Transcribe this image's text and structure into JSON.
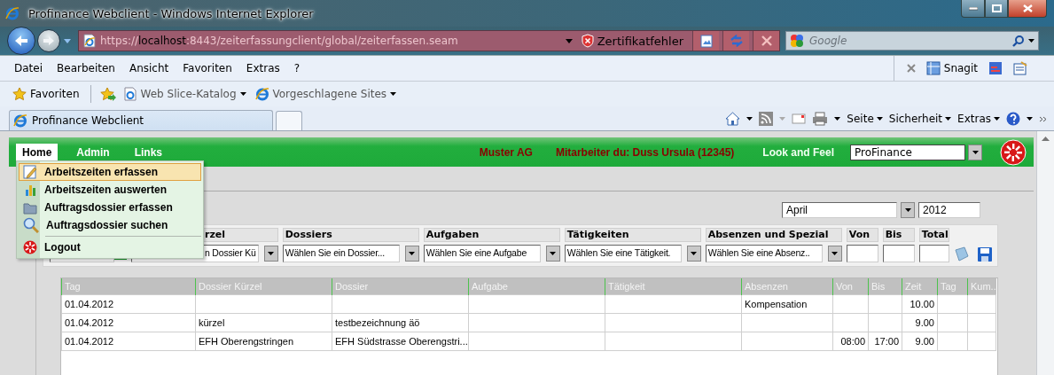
{
  "window": {
    "title": "Profinance Webclient - Windows Internet Explorer"
  },
  "address_bar": {
    "url_scheme": "https://",
    "host": "localhost",
    "url_path": ":8443/zeiterfassungclient/global/zeiterfassen.seam",
    "certificate_error": "Zertifikatfehler"
  },
  "search": {
    "placeholder": "Google"
  },
  "menu_bar": [
    "Datei",
    "Bearbeiten",
    "Ansicht",
    "Favoriten",
    "Extras",
    "?"
  ],
  "snagit": "Snagit",
  "favorites_bar": {
    "favorites": "Favoriten",
    "links": [
      "Web Slice-Katalog",
      "Vorgeschlagene Sites"
    ]
  },
  "tabs": [
    {
      "label": "Profinance Webclient",
      "selected": true
    }
  ],
  "command_bar": [
    "Seite",
    "Sicherheit",
    "Extras"
  ],
  "app": {
    "nav": [
      {
        "label": "Home",
        "selected": true
      },
      {
        "label": "Admin",
        "selected": false
      },
      {
        "label": "Links",
        "selected": false
      }
    ],
    "company": "Muster AG",
    "employee": "Mitarbeiter du: Duss Ursula (12345)",
    "look_label": "Look and Feel",
    "look_value": "ProFinance"
  },
  "home_menu": [
    {
      "label": "Arbeitszeiten erfassen",
      "selected": true
    },
    {
      "label": "Arbeitszeiten auswerten",
      "selected": false
    },
    {
      "label": "Auftragsdossier erfassen",
      "selected": false
    },
    {
      "label": "Auftragsdossier suchen",
      "selected": false
    },
    {
      "label": "Logout",
      "selected": false
    }
  ],
  "period": {
    "month": "April",
    "year": "2012"
  },
  "filters": [
    {
      "kind": "date"
    },
    {
      "kind": "select",
      "label": "rzel",
      "value": "n Dossier Kü"
    },
    {
      "kind": "select",
      "label": "Dossiers",
      "value": "Wählen Sie ein Dossier..."
    },
    {
      "kind": "select",
      "label": "Aufgaben",
      "value": "Wählen Sie eine Aufgabe"
    },
    {
      "kind": "select",
      "label": "Tätigkeiten",
      "value": "Wählen Sie eine Tätigkeit."
    },
    {
      "kind": "select",
      "label": "Absenzen und Spezial",
      "value": "Wählen Sie eine Absenz.."
    },
    {
      "kind": "input",
      "label": "Von"
    },
    {
      "kind": "input",
      "label": "Bis"
    },
    {
      "kind": "input",
      "label": "Total"
    }
  ],
  "table": {
    "columns": [
      "Tag",
      "Dossier Kürzel",
      "Dossier",
      "Aufgabe",
      "Tätigkeit",
      "Absenzen",
      "Von",
      "Bis",
      "Zeit",
      "Tag",
      "Kum.."
    ],
    "rows": [
      [
        "01.04.2012",
        "",
        "",
        "",
        "",
        "Kompensation",
        "",
        "",
        "10.00",
        "",
        ""
      ],
      [
        "01.04.2012",
        "kürzel",
        "testbezeichnung äö",
        "",
        "",
        "",
        "",
        "",
        "9.00",
        "",
        ""
      ],
      [
        "01.04.2012",
        "EFH Oberengstringen",
        "EFH Südstrasse Oberengstri...",
        "",
        "",
        "",
        "08:00",
        "17:00",
        "9.00",
        "",
        ""
      ]
    ]
  }
}
